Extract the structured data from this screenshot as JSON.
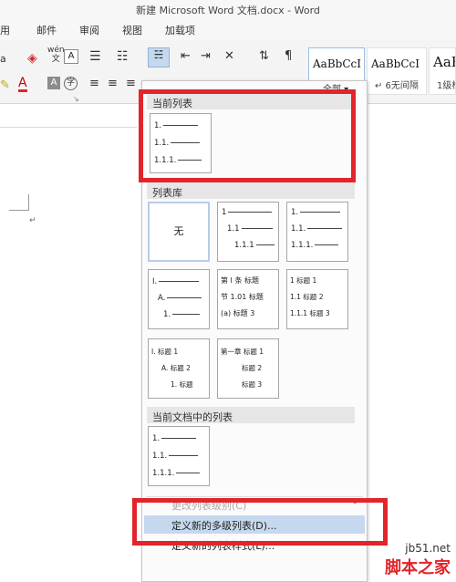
{
  "window": {
    "title": "新建 Microsoft Word 文档.docx - Word"
  },
  "ribbon_tabs": [
    "用",
    "邮件",
    "审阅",
    "视图",
    "加载项"
  ],
  "ribbon": {
    "font_a_label": "a",
    "wen_label": "wén\n文",
    "boxed_a": "A",
    "styles_more_label": "全部",
    "styles": [
      {
        "sample": "AaBbCcI",
        "name": ""
      },
      {
        "sample": "AaBbCcI",
        "name": "↵ 6无间隔"
      },
      {
        "sample": "AaB",
        "name": "1级标"
      }
    ]
  },
  "panel": {
    "current_list_header": "当前列表",
    "current_list_lines": [
      "1.",
      "1.1.",
      "1.1.1."
    ],
    "library_header": "列表库",
    "library": [
      {
        "type": "none",
        "label": "无"
      },
      {
        "type": "lines",
        "lines": [
          "1",
          "1.1",
          "1.1.1"
        ]
      },
      {
        "type": "lines",
        "lines": [
          "1.",
          "1.1.",
          "1.1.1."
        ]
      },
      {
        "type": "lines",
        "lines": [
          "I.",
          "A.",
          "1."
        ]
      },
      {
        "type": "lines",
        "lines": [
          "第 I 条 标题",
          "节 1.01 标题",
          "(a) 标题 3"
        ]
      },
      {
        "type": "lines",
        "lines": [
          "1 标题 1",
          "1.1 标题 2",
          "1.1.1 标题 3"
        ]
      },
      {
        "type": "lines",
        "lines": [
          "I. 标题 1",
          "A. 标题 2",
          "1. 标题"
        ]
      },
      {
        "type": "lines",
        "lines": [
          "第一章 标题 1",
          "标题 2",
          "标题 3"
        ]
      }
    ],
    "doc_lists_header": "当前文档中的列表",
    "doc_list_lines": [
      "1.",
      "1.1.",
      "1.1.1."
    ],
    "menu_items": [
      {
        "label": "更改列表级别(C)",
        "selected": false
      },
      {
        "label": "定义新的多级列表(D)...",
        "selected": true
      },
      {
        "label": "定义新的列表样式(L)...",
        "selected": false
      }
    ]
  },
  "watermark": {
    "site": "jb51.net",
    "brand": "脚本之家"
  }
}
